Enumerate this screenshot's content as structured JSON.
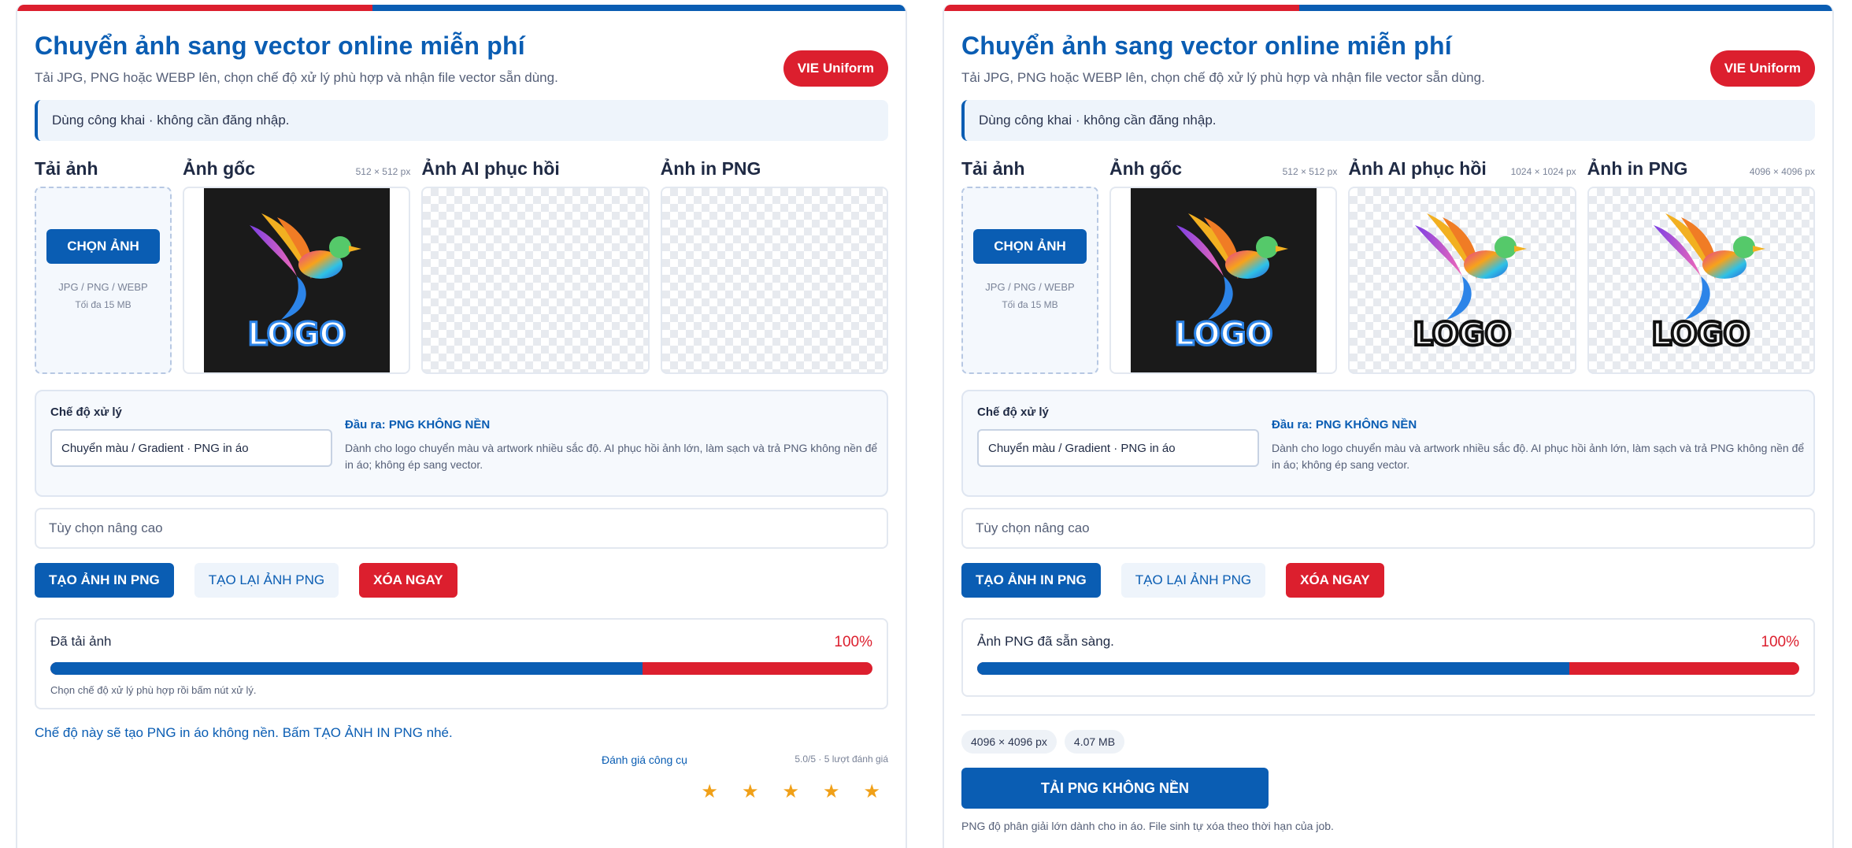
{
  "left": {
    "title": "Chuyển ảnh sang vector online miễn phí",
    "subtitle": "Tải JPG, PNG hoặc WEBP lên, chọn chế độ xử lý phù hợp và nhận file vector sẵn dùng.",
    "brand_button": "VIE Uniform",
    "notice": "Dùng công khai · không cần đăng nhập.",
    "columns": {
      "upload": {
        "label": "Tải ảnh"
      },
      "original": {
        "label": "Ảnh gốc",
        "size": "512 × 512 px"
      },
      "restored": {
        "label": "Ảnh AI phục hồi",
        "size": ""
      },
      "print": {
        "label": "Ảnh in PNG",
        "size": ""
      }
    },
    "upload": {
      "button": "CHỌN ẢNH",
      "formats": "JPG / PNG / WEBP",
      "max": "Tối đa 15 MB"
    },
    "mode": {
      "label": "Chế độ xử lý",
      "selected": "Chuyển màu / Gradient · PNG in áo",
      "output_prefix": "Đầu ra: ",
      "output": "PNG KHÔNG NỀN",
      "description": "Dành cho logo chuyển màu và artwork nhiều sắc độ. AI phục hồi ảnh lớn, làm sạch và trả PNG không nền để in áo; không ép sang vector."
    },
    "advanced": "Tùy chọn nâng cao",
    "actions": {
      "create": "TẠO ẢNH IN PNG",
      "recreate": "TẠO LẠI ẢNH PNG",
      "delete": "XÓA NGAY"
    },
    "progress": {
      "status": "Đã tải ảnh",
      "percent_label": "100%",
      "fill_fraction": 0.72,
      "hint": "Chọn chế độ xử lý phù hợp rồi bấm nút xử lý."
    },
    "note": "Chế độ này sẽ tạo PNG in áo không nền. Bấm TẠO ẢNH IN PNG nhé.",
    "rating": {
      "title": "Đánh giá công cụ",
      "score": "5.0/5 · 5 lượt đánh giá",
      "stars": [
        "★",
        "★",
        "★",
        "★",
        "★"
      ]
    }
  },
  "right": {
    "title": "Chuyển ảnh sang vector online miễn phí",
    "subtitle": "Tải JPG, PNG hoặc WEBP lên, chọn chế độ xử lý phù hợp và nhận file vector sẵn dùng.",
    "brand_button": "VIE Uniform",
    "notice": "Dùng công khai · không cần đăng nhập.",
    "columns": {
      "upload": {
        "label": "Tải ảnh"
      },
      "original": {
        "label": "Ảnh gốc",
        "size": "512 × 512 px"
      },
      "restored": {
        "label": "Ảnh AI phục hồi",
        "size": "1024 × 1024 px"
      },
      "print": {
        "label": "Ảnh in PNG",
        "size": "4096 × 4096 px"
      }
    },
    "upload": {
      "button": "CHỌN ẢNH",
      "formats": "JPG / PNG / WEBP",
      "max": "Tối đa 15 MB"
    },
    "mode": {
      "label": "Chế độ xử lý",
      "selected": "Chuyển màu / Gradient · PNG in áo",
      "output_prefix": "Đầu ra: ",
      "output": "PNG KHÔNG NỀN",
      "description": "Dành cho logo chuyển màu và artwork nhiều sắc độ. AI phục hồi ảnh lớn, làm sạch và trả PNG không nền để in áo; không ép sang vector."
    },
    "advanced": "Tùy chọn nâng cao",
    "actions": {
      "create": "TẠO ẢNH IN PNG",
      "recreate": "TẠO LẠI ẢNH PNG",
      "delete": "XÓA NGAY"
    },
    "progress": {
      "status": "Ảnh PNG đã sẵn sàng.",
      "percent_label": "100%",
      "fill_fraction": 0.72
    },
    "result": {
      "dimensions": "4096 × 4096 px",
      "filesize": "4.07 MB",
      "download": "TẢI PNG KHÔNG NỀN",
      "footnote": "PNG độ phân giải lớn dành cho in áo. File sinh tự xóa theo thời hạn của job."
    }
  },
  "logo_text": "LOGO",
  "colors": {
    "brand_blue": "#0a5db3",
    "brand_red": "#dc1f2e",
    "star": "#f0a018"
  }
}
